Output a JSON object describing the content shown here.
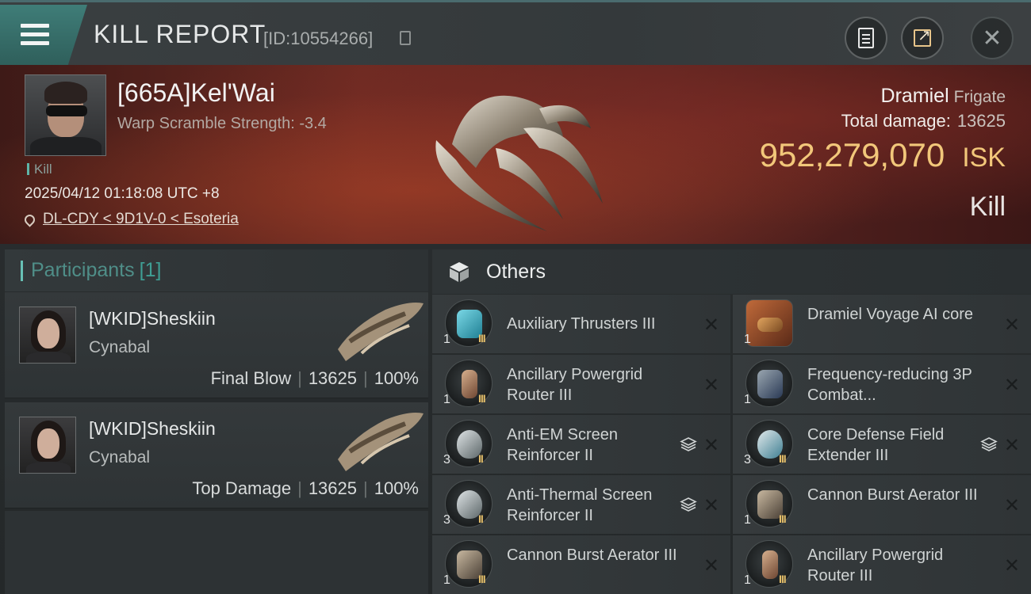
{
  "header": {
    "title": "KILL REPORT",
    "id_text": "[ID:10554266]"
  },
  "victim": {
    "name": "[665A]Kel'Wai",
    "warp_text": "Warp Scramble Strength: -3.4",
    "tag": "Kill",
    "datetime": "2025/04/12 01:18:08 UTC +8",
    "location": "DL-CDY < 9D1V-0 < Esoteria",
    "ship_name": "Dramiel",
    "ship_class": "Frigate",
    "total_damage_label": "Total damage:",
    "total_damage": "13625",
    "isk_value": "952,279,070",
    "isk_unit": "ISK",
    "result": "Kill"
  },
  "participants": {
    "label": "Participants",
    "count": "[1]",
    "cards": [
      {
        "name": "[WKID]Sheskiin",
        "ship": "Cynabal",
        "role": "Final Blow",
        "damage": "13625",
        "percent": "100%"
      },
      {
        "name": "[WKID]Sheskiin",
        "ship": "Cynabal",
        "role": "Top Damage",
        "damage": "13625",
        "percent": "100%"
      }
    ]
  },
  "others": {
    "title": "Others",
    "items": [
      {
        "name": "Auxiliary Thrusters III",
        "qty": "1",
        "tier": "III"
      },
      {
        "name": "Dramiel Voyage AI core",
        "qty": "1",
        "tier": ""
      },
      {
        "name": "Ancillary Powergrid Router III",
        "qty": "1",
        "tier": "III"
      },
      {
        "name": "Frequency-reducing 3P Combat...",
        "qty": "1",
        "tier": ""
      },
      {
        "name": "Anti-EM Screen Reinforcer II",
        "qty": "3",
        "tier": "II"
      },
      {
        "name": "Core Defense Field Extender III",
        "qty": "3",
        "tier": "III"
      },
      {
        "name": "Anti-Thermal Screen Reinforcer II",
        "qty": "3",
        "tier": "II"
      },
      {
        "name": "Cannon Burst Aerator III",
        "qty": "1",
        "tier": "III"
      },
      {
        "name": "Cannon Burst Aerator III",
        "qty": "1",
        "tier": "III"
      },
      {
        "name": "Ancillary Powergrid Router III",
        "qty": "1",
        "tier": "III"
      }
    ]
  },
  "icons": {
    "menu": "hamburger-icon",
    "copy": "copy-icon",
    "clipboard": "clipboard-icon",
    "share": "share-icon",
    "close": "close-icon",
    "location": "location-pin-icon",
    "others": "cube-icon",
    "stack": "stack-layers-icon",
    "remove": "x-icon"
  },
  "colors": {
    "accent_teal": "#5eb5a8",
    "isk_gold": "#f2c77a",
    "tier_gold": "#e6c06b",
    "banner_red": "#6b2a22"
  }
}
